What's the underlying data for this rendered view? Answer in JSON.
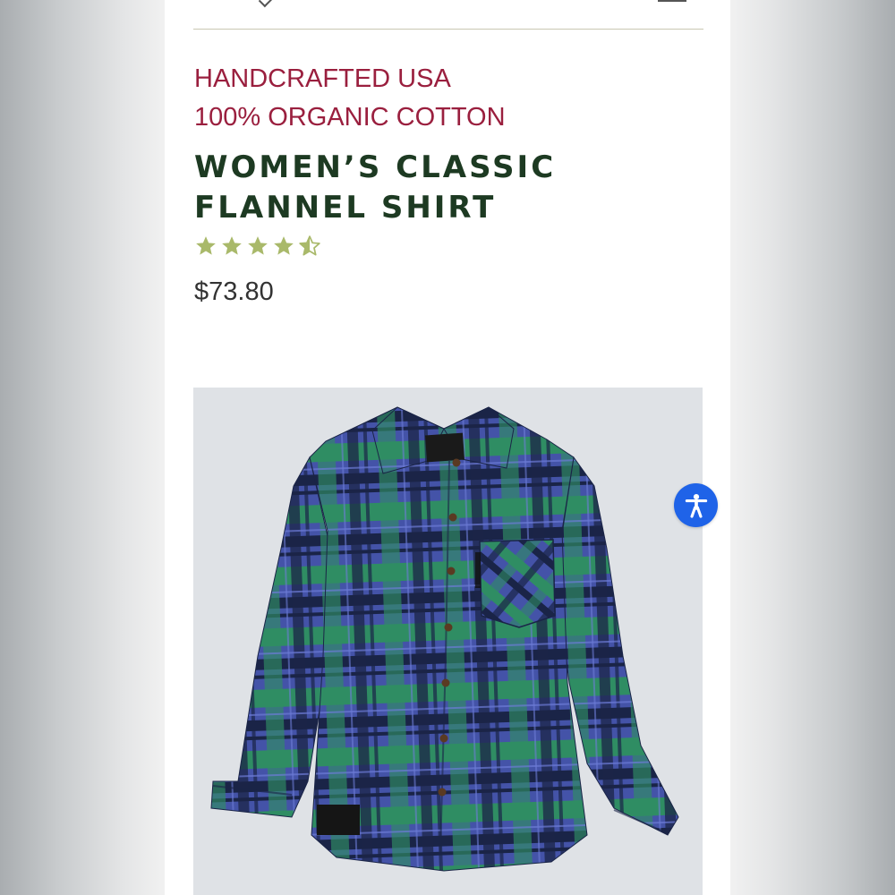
{
  "product": {
    "eyebrow_line1": "HANDCRAFTED USA",
    "eyebrow_line2": "100% ORGANIC COTTON",
    "title_line1": "WOMEN’S CLASSIC",
    "title_line2": "FLANNEL SHIRT",
    "rating": {
      "value": 4.5,
      "max": 5,
      "color": "#a9b96a"
    },
    "price": "$73.80",
    "image": {
      "icon": "plaid-flannel-shirt",
      "colors": [
        "#4453a8",
        "#2f8d63",
        "#1a2447"
      ]
    }
  },
  "accessibility_button": {
    "icon": "accessibility-person-icon",
    "color": "#1f63e8"
  },
  "colors": {
    "eyebrow": "#9a1f3e",
    "title": "#1d3a22",
    "price": "#333333"
  }
}
